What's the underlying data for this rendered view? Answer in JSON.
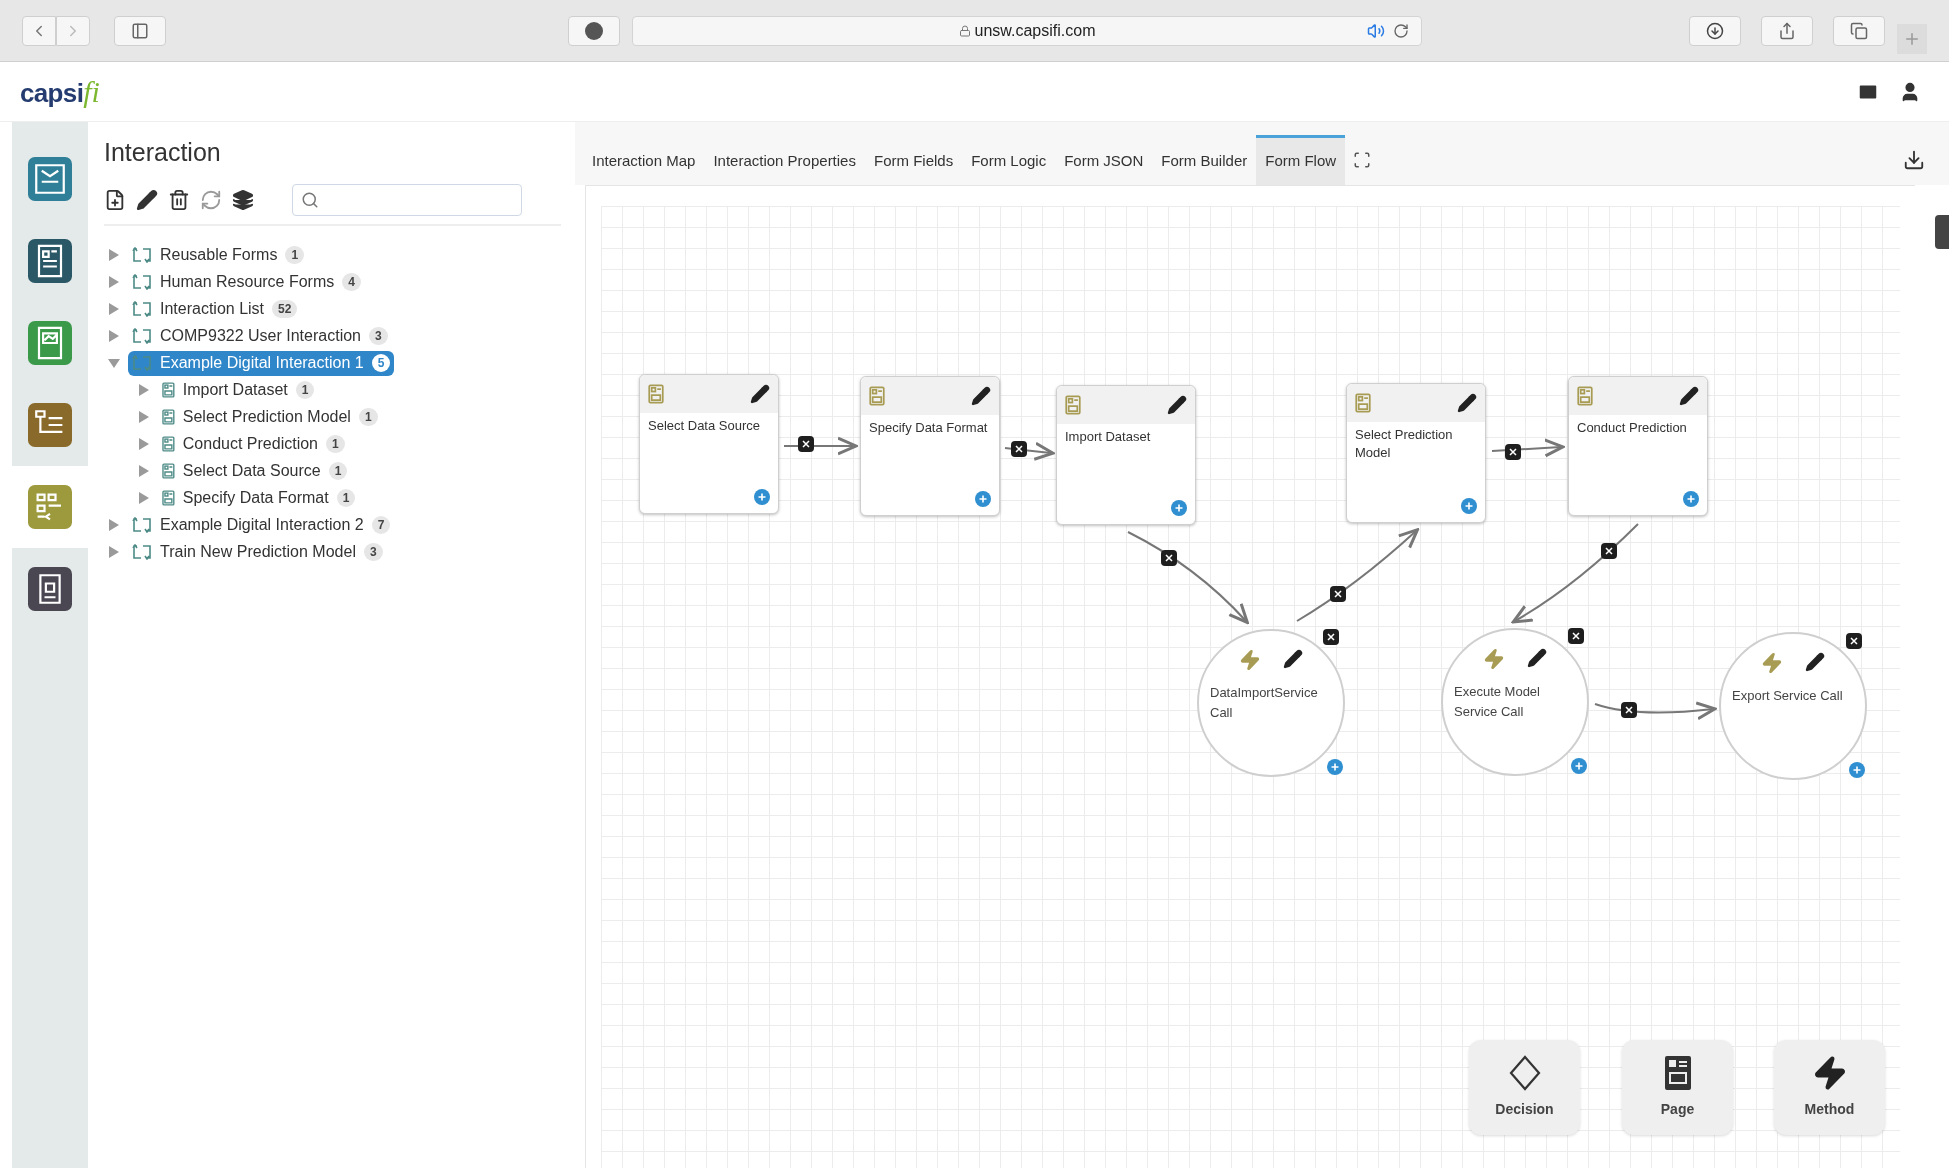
{
  "browser": {
    "url": "unsw.capsifi.com"
  },
  "header": {
    "logo": "capsi",
    "logo_accent": "fi"
  },
  "rail": [
    {
      "color": "#2f7f98",
      "selected": false
    },
    {
      "color": "#2b5866",
      "selected": false
    },
    {
      "color": "#3a9a4a",
      "selected": false
    },
    {
      "color": "#8a6a2a",
      "selected": false
    },
    {
      "color": "#9c9a3c",
      "selected": true
    },
    {
      "color": "#4a4652",
      "selected": false
    }
  ],
  "panel": {
    "title": "Interaction",
    "tree": [
      {
        "kind": "folder",
        "label": "Reusable Forms",
        "count": "1",
        "expanded": false,
        "selected": false
      },
      {
        "kind": "folder",
        "label": "Human Resource Forms",
        "count": "4",
        "expanded": false,
        "selected": false
      },
      {
        "kind": "folder",
        "label": "Interaction List",
        "count": "52",
        "expanded": false,
        "selected": false
      },
      {
        "kind": "folder",
        "label": "COMP9322 User Interaction",
        "count": "3",
        "expanded": false,
        "selected": false
      },
      {
        "kind": "folder",
        "label": "Example Digital Interaction 1",
        "count": "5",
        "expanded": true,
        "selected": true,
        "children": [
          {
            "kind": "form",
            "label": "Import Dataset",
            "count": "1",
            "expanded": false,
            "selected": false
          },
          {
            "kind": "form",
            "label": "Select Prediction Model",
            "count": "1",
            "expanded": false,
            "selected": false
          },
          {
            "kind": "form",
            "label": "Conduct Prediction",
            "count": "1",
            "expanded": false,
            "selected": false
          },
          {
            "kind": "form",
            "label": "Select Data Source",
            "count": "1",
            "expanded": false,
            "selected": false
          },
          {
            "kind": "form",
            "label": "Specify Data Format",
            "count": "1",
            "expanded": false,
            "selected": false
          }
        ]
      },
      {
        "kind": "folder",
        "label": "Example Digital Interaction 2",
        "count": "7",
        "expanded": false,
        "selected": false
      },
      {
        "kind": "folder",
        "label": "Train New Prediction Model",
        "count": "3",
        "expanded": false,
        "selected": false
      }
    ]
  },
  "tabs": [
    {
      "label": "Interaction Map",
      "selected": false
    },
    {
      "label": "Interaction Properties",
      "selected": false
    },
    {
      "label": "Form Fields",
      "selected": false
    },
    {
      "label": "Form Logic",
      "selected": false
    },
    {
      "label": "Form JSON",
      "selected": false
    },
    {
      "label": "Form Builder",
      "selected": false
    },
    {
      "label": "Form Flow",
      "selected": true
    }
  ],
  "flow": {
    "nodes": [
      {
        "kind": "page",
        "label": "Select Data Source"
      },
      {
        "kind": "page",
        "label": "Specify Data Format"
      },
      {
        "kind": "page",
        "label": "Import Dataset"
      },
      {
        "kind": "page",
        "label": "Select Prediction Model"
      },
      {
        "kind": "page",
        "label": "Conduct Prediction"
      },
      {
        "kind": "method",
        "label": "DataImportService Call"
      },
      {
        "kind": "method",
        "label": "Execute Model Service Call"
      },
      {
        "kind": "method",
        "label": "Export Service Call"
      }
    ],
    "palette": [
      {
        "kind": "decision",
        "label": "Decision"
      },
      {
        "kind": "page",
        "label": "Page"
      },
      {
        "kind": "method",
        "label": "Method"
      }
    ]
  }
}
